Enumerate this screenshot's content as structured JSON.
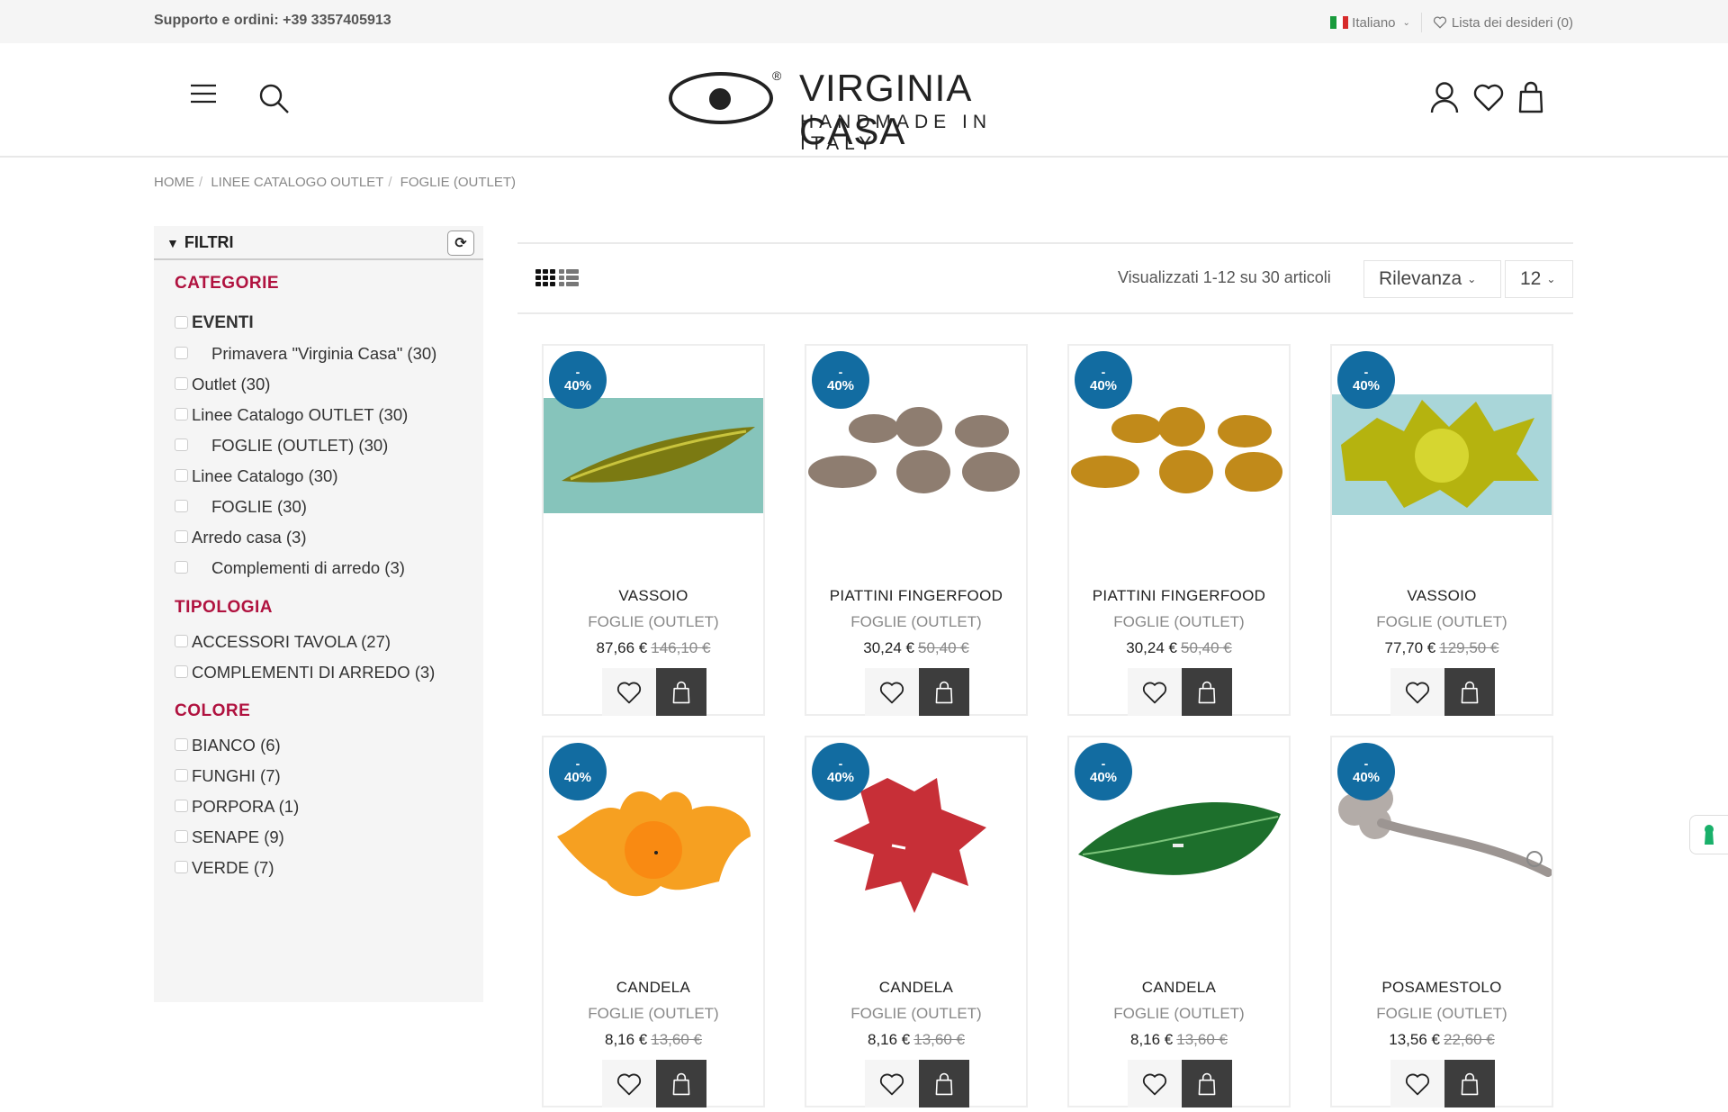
{
  "topbar": {
    "support": "Supporto e ordini: +39 3357405913",
    "language": "Italiano",
    "wishlist": "Lista dei desideri (0)"
  },
  "brand": {
    "name": "VIRGINIA CASA",
    "tagline": "HANDMADE IN ITALY",
    "registered": "®"
  },
  "header_icons": [
    "menu-icon",
    "search-icon",
    "user-icon",
    "heart-icon",
    "shopping-bag-icon"
  ],
  "breadcrumb": [
    "HOME",
    "LINEE CATALOGO OUTLET",
    "FOGLIE (OUTLET)"
  ],
  "filters": {
    "title": "FILTRI",
    "sections": [
      {
        "title": "CATEGORIE",
        "items": [
          {
            "label": "EVENTI",
            "style": "bold"
          },
          {
            "label": "Primavera \"Virginia Casa\" (30)",
            "style": "indent"
          },
          {
            "label": "Outlet (30)",
            "style": ""
          },
          {
            "label": "Linee Catalogo OUTLET (30)",
            "style": ""
          },
          {
            "label": "FOGLIE (OUTLET) (30)",
            "style": "indent"
          },
          {
            "label": "Linee Catalogo (30)",
            "style": ""
          },
          {
            "label": "FOGLIE (30)",
            "style": "indent"
          },
          {
            "label": "Arredo casa (3)",
            "style": ""
          },
          {
            "label": "Complementi di arredo (3)",
            "style": "indent"
          }
        ]
      },
      {
        "title": "TIPOLOGIA",
        "items": [
          {
            "label": "ACCESSORI TAVOLA (27)",
            "style": ""
          },
          {
            "label": "COMPLEMENTI DI ARREDO (3)",
            "style": ""
          }
        ]
      },
      {
        "title": "COLORE",
        "items": [
          {
            "label": "BIANCO (6)",
            "style": ""
          },
          {
            "label": "FUNGHI (7)",
            "style": ""
          },
          {
            "label": "PORPORA (1)",
            "style": ""
          },
          {
            "label": "SENAPE (9)",
            "style": ""
          },
          {
            "label": "VERDE (7)",
            "style": ""
          }
        ]
      }
    ]
  },
  "listing": {
    "count_text": "Visualizzati 1-12 su 30 articoli",
    "sort": "Rilevanza",
    "per_page": "12"
  },
  "products": [
    {
      "name": "VASSOIO",
      "category": "FOGLIE (OUTLET)",
      "price": "87,66 €",
      "old_price": "146,10 €",
      "discount": "-\n40%",
      "image": "green-leaf-tray"
    },
    {
      "name": "PIATTINI FINGERFOOD",
      "category": "FOGLIE (OUTLET)",
      "price": "30,24 €",
      "old_price": "50,40 €",
      "discount": "-\n40%",
      "image": "brown-leaf-plates"
    },
    {
      "name": "PIATTINI FINGERFOOD",
      "category": "FOGLIE (OUTLET)",
      "price": "30,24 €",
      "old_price": "50,40 €",
      "discount": "-\n40%",
      "image": "mustard-leaf-plates"
    },
    {
      "name": "VASSOIO",
      "category": "FOGLIE (OUTLET)",
      "price": "77,70 €",
      "old_price": "129,50 €",
      "discount": "-\n40%",
      "image": "yellow-leaf-tray"
    },
    {
      "name": "CANDELA",
      "category": "FOGLIE (OUTLET)",
      "price": "8,16 €",
      "old_price": "13,60 €",
      "discount": "-\n40%",
      "image": "orange-oak-candle"
    },
    {
      "name": "CANDELA",
      "category": "FOGLIE (OUTLET)",
      "price": "8,16 €",
      "old_price": "13,60 €",
      "discount": "-\n40%",
      "image": "red-maple-candle"
    },
    {
      "name": "CANDELA",
      "category": "FOGLIE (OUTLET)",
      "price": "8,16 €",
      "old_price": "13,60 €",
      "discount": "-\n40%",
      "image": "green-leaf-candle"
    },
    {
      "name": "POSAMESTOLO",
      "category": "FOGLIE (OUTLET)",
      "price": "13,56 €",
      "old_price": "22,60 €",
      "discount": "-\n40%",
      "image": "grey-clover-ladle-rest"
    }
  ],
  "colors": {
    "accent": "#b0123f",
    "badge": "#126ca1",
    "cart_button": "#3d3d3d"
  }
}
